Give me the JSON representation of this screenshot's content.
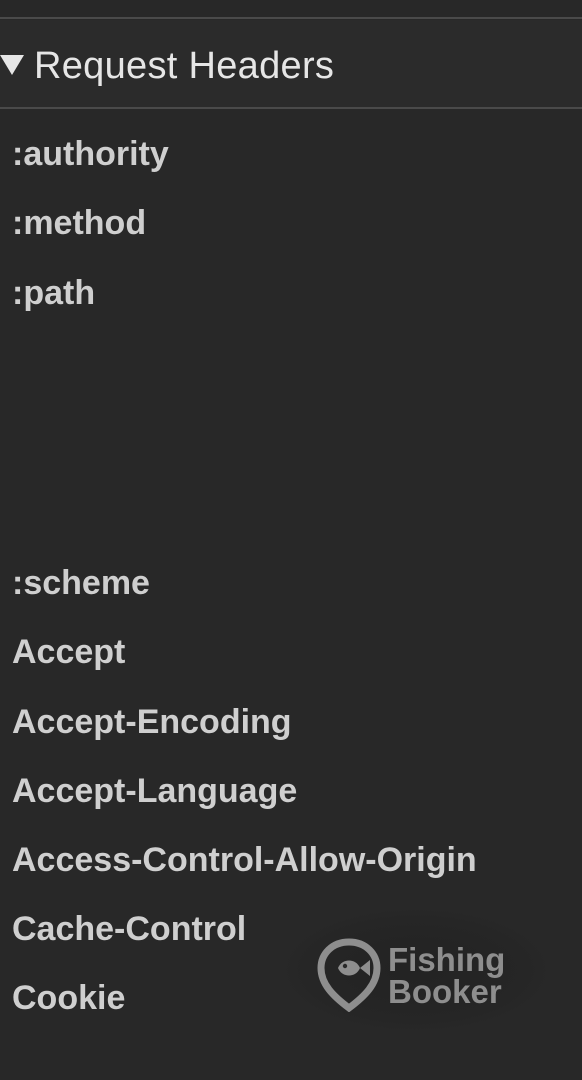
{
  "section": {
    "title": "Request Headers",
    "disclosure_icon": "triangle-down-icon"
  },
  "headers": [
    ":authority",
    ":method",
    ":path",
    ":scheme",
    "Accept",
    "Accept-Encoding",
    "Accept-Language",
    "Access-Control-Allow-Origin",
    "Cache-Control",
    "Cookie"
  ],
  "watermark": {
    "line1": "Fishing",
    "line2": "Booker",
    "icon": "fish-hook-logo-icon"
  },
  "colors": {
    "background": "#282828",
    "text": "#cfcfcf",
    "title": "#e6e6e6",
    "divider": "#4a4a4a",
    "watermark": "#8e8e8e"
  }
}
